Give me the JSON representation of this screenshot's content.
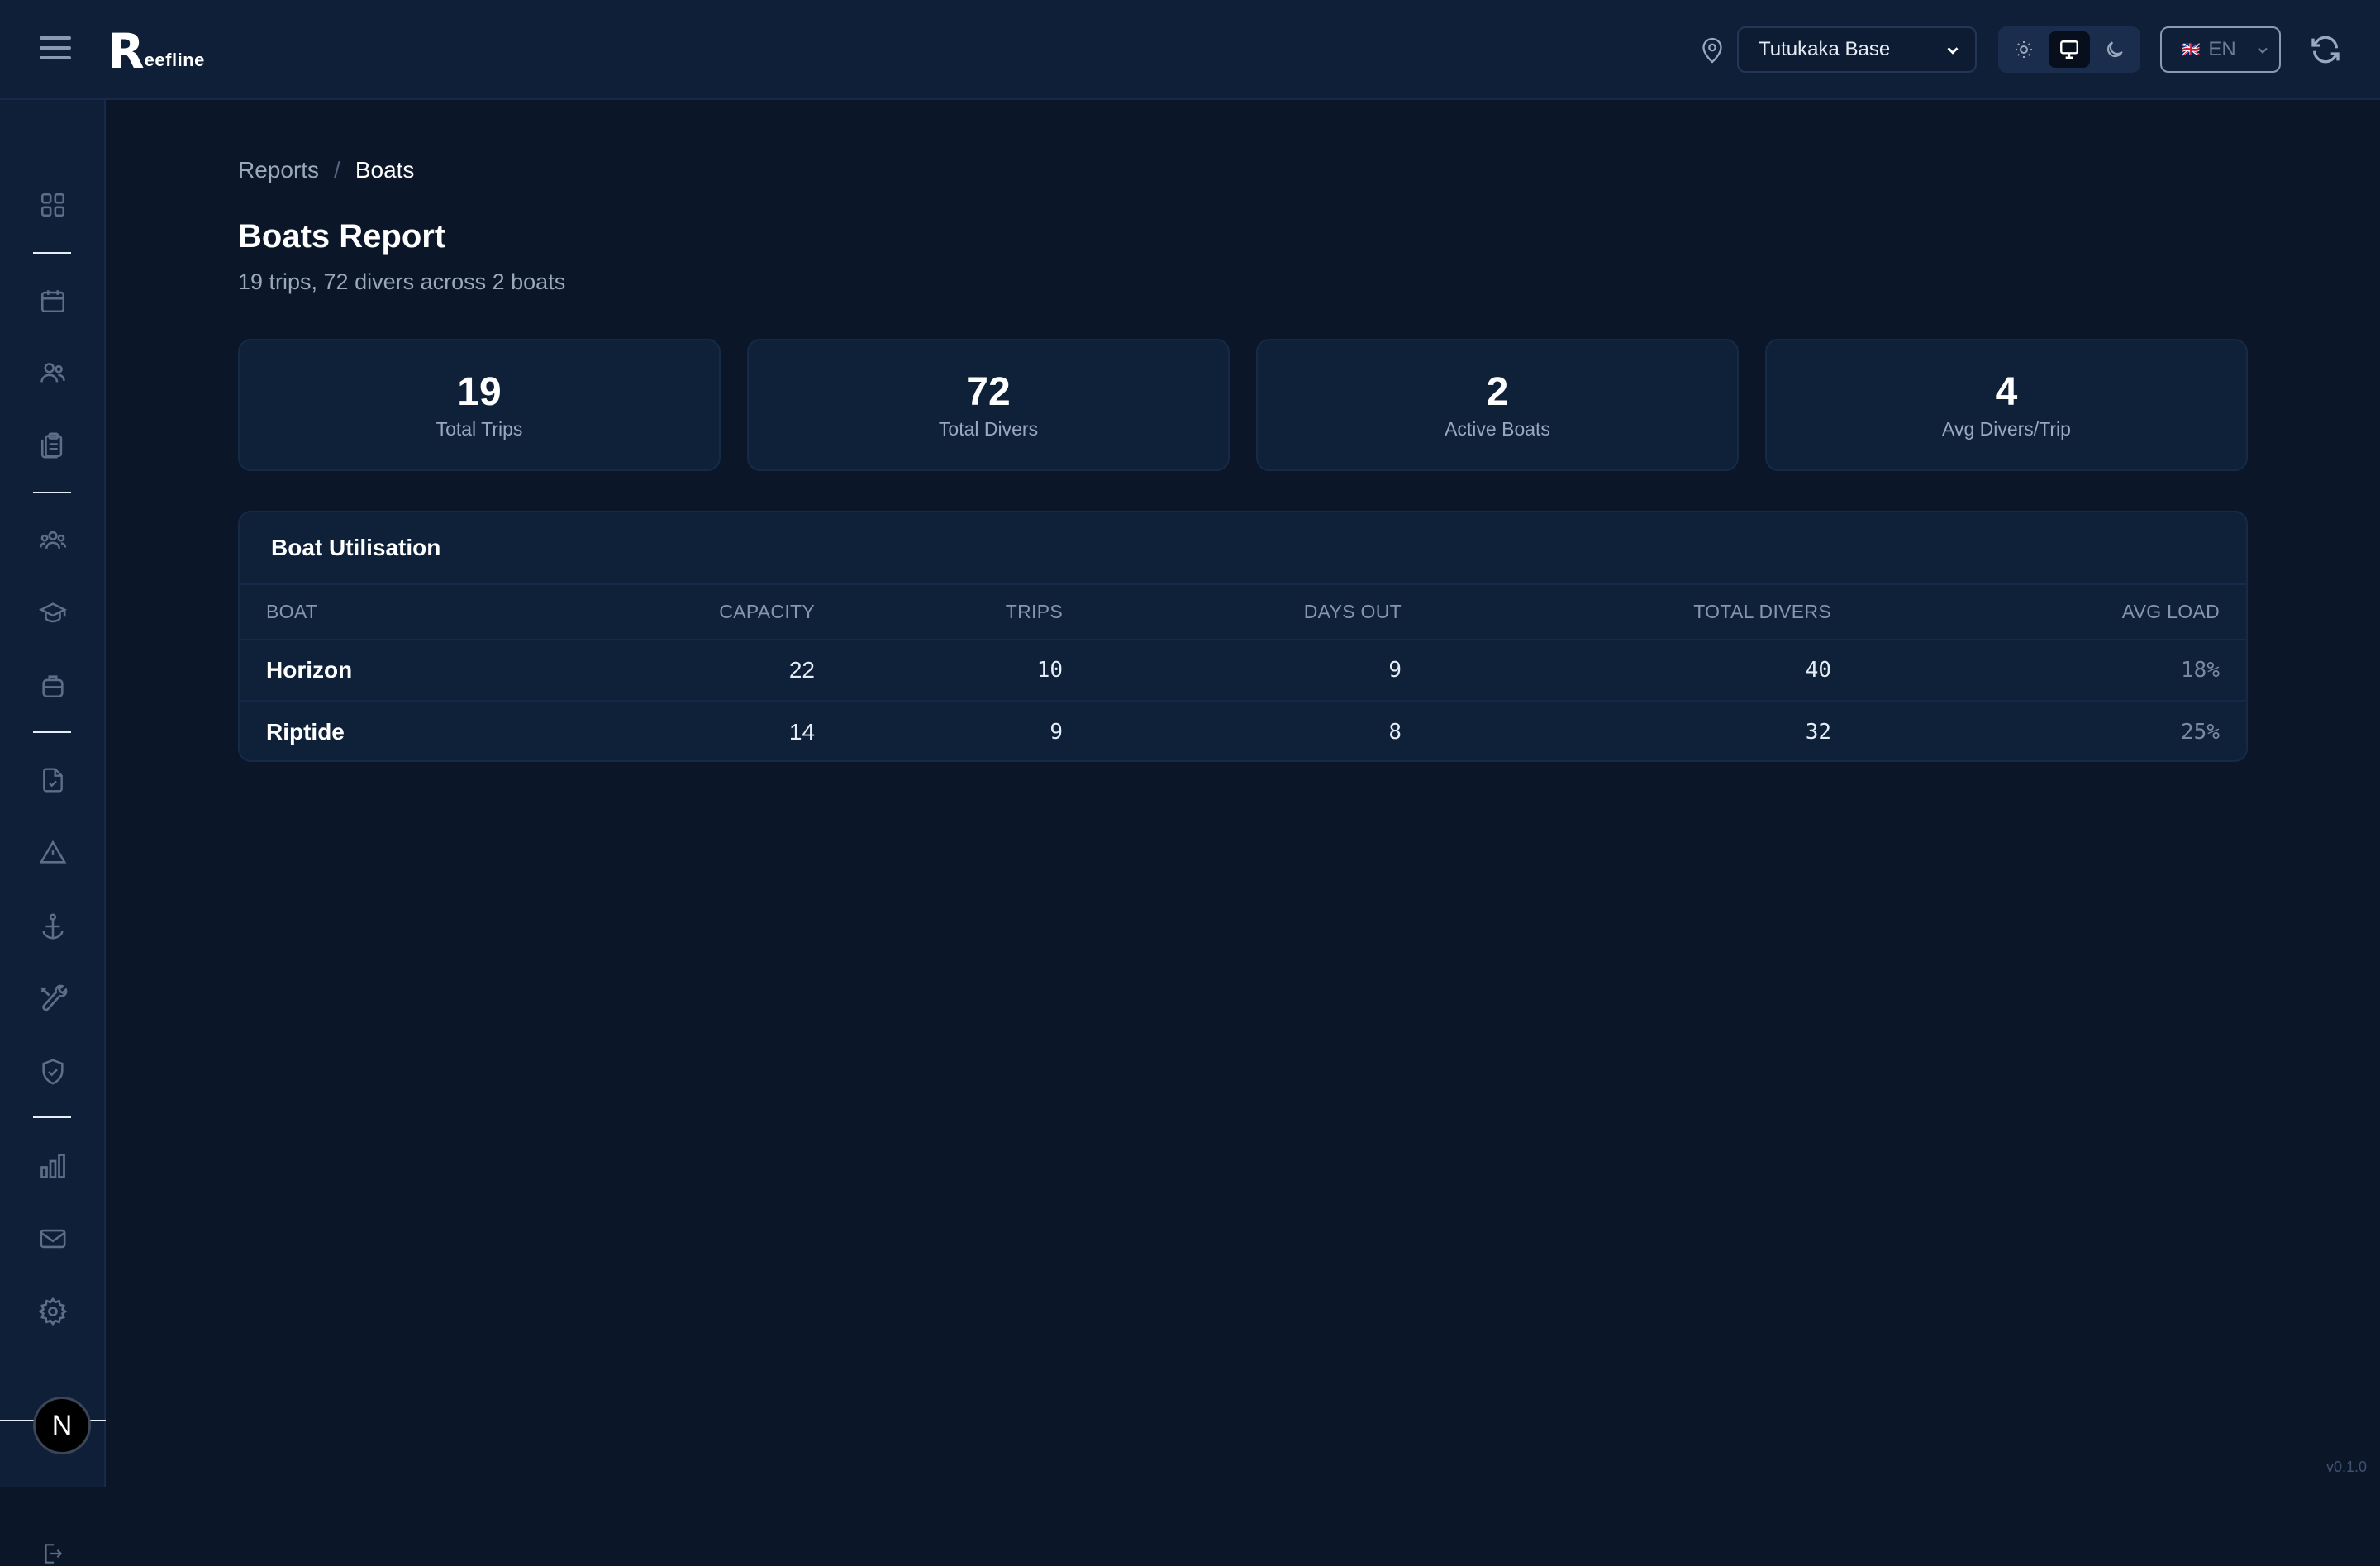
{
  "app": {
    "logo_letter": "R",
    "logo_text": "eefline",
    "version": "v0.1.0"
  },
  "header": {
    "location": {
      "value": "Tutukaka Base",
      "icon": "map-pin-icon"
    },
    "theme_options": [
      {
        "name": "light",
        "icon": "sun-icon",
        "active": false
      },
      {
        "name": "system",
        "icon": "monitor-icon",
        "active": true
      },
      {
        "name": "dark",
        "icon": "moon-icon",
        "active": false
      }
    ],
    "language": {
      "flag": "🇬🇧",
      "code": "EN"
    },
    "refresh_icon": "refresh-icon"
  },
  "sidebar": {
    "items": [
      "dashboard-grid-icon",
      "calendar-icon",
      "customers-icon",
      "clipboard-icon",
      "team-icon",
      "courses-icon",
      "equipment-icon",
      "document-check-icon",
      "incident-icon",
      "boat-anchor-icon",
      "tools-icon",
      "shield-check-icon",
      "reports-chart-icon",
      "mail-icon",
      "settings-icon"
    ],
    "user_initial": "N"
  },
  "breadcrumb": {
    "parent": "Reports",
    "separator": "/",
    "current": "Boats"
  },
  "page": {
    "title": "Boats Report",
    "subtitle": "19 trips, 72 divers across 2 boats"
  },
  "stats": [
    {
      "value": "19",
      "label": "Total Trips"
    },
    {
      "value": "72",
      "label": "Total Divers"
    },
    {
      "value": "2",
      "label": "Active Boats"
    },
    {
      "value": "4",
      "label": "Avg Divers/Trip"
    }
  ],
  "table": {
    "title": "Boat Utilisation",
    "headers": [
      "BOAT",
      "CAPACITY",
      "TRIPS",
      "DAYS OUT",
      "TOTAL DIVERS",
      "AVG LOAD"
    ],
    "rows": [
      {
        "boat": "Horizon",
        "capacity": "22",
        "trips": "10",
        "days_out": "9",
        "total_divers": "40",
        "avg_load": "18%"
      },
      {
        "boat": "Riptide",
        "capacity": "14",
        "trips": "9",
        "days_out": "8",
        "total_divers": "32",
        "avg_load": "25%"
      }
    ]
  },
  "colors": {
    "background": "#0b1628",
    "panel": "#0f1f37",
    "card": "#0f2039",
    "text_muted": "#9aa8bd"
  }
}
